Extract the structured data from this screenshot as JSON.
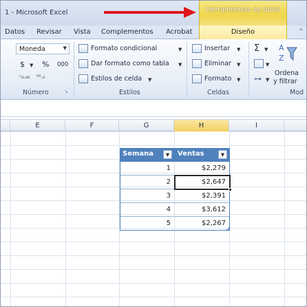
{
  "window": {
    "title": "1 - Microsoft Excel"
  },
  "context_tab": {
    "label": "Herramientas de tabla"
  },
  "tabs": [
    "Datos",
    "Revisar",
    "Vista",
    "Complementos",
    "Acrobat",
    "Diseño"
  ],
  "ribbon": {
    "number_group": {
      "label": "Número",
      "format_value": "Moneda",
      "currency_symbol": "$",
      "percent_symbol": "%",
      "thousands": "000"
    },
    "styles_group": {
      "label": "Estilos",
      "conditional": "Formato condicional",
      "as_table": "Dar formato como tabla",
      "cell_styles": "Estilos de celda"
    },
    "cells_group": {
      "label": "Celdas",
      "insert": "Insertar",
      "delete": "Eliminar",
      "format": "Formato"
    },
    "editing_group": {
      "sum_symbol": "Σ",
      "sort_line1": "Ordena",
      "sort_line2": "y filtrar",
      "label": "Mod"
    }
  },
  "columns": [
    "E",
    "F",
    "G",
    "H",
    "I"
  ],
  "active_column": "H",
  "table": {
    "headers": [
      "Semana",
      "Ventas"
    ],
    "rows": [
      {
        "semana": "1",
        "ventas": "$2,279"
      },
      {
        "semana": "2",
        "ventas": "$2,647"
      },
      {
        "semana": "3",
        "ventas": "$2,391"
      },
      {
        "semana": "4",
        "ventas": "$3,612"
      },
      {
        "semana": "5",
        "ventas": "$2,267"
      }
    ],
    "selected_row": 2
  },
  "colors": {
    "table_header": "#4f81bd",
    "context_tab": "#efd64c",
    "arrow": "#e0171c"
  }
}
